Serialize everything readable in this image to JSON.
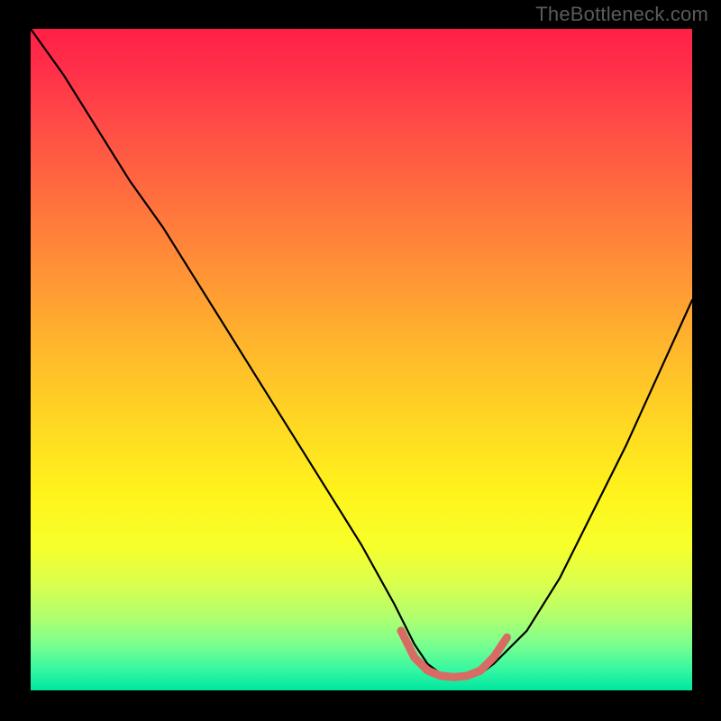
{
  "watermark": "TheBottleneck.com",
  "chart_data": {
    "type": "line",
    "title": "",
    "xlabel": "",
    "ylabel": "",
    "xlim": [
      0,
      100
    ],
    "ylim": [
      0,
      100
    ],
    "grid": false,
    "legend": false,
    "annotations": [],
    "series": [
      {
        "name": "curve",
        "color": "#000000",
        "x": [
          0,
          5,
          10,
          15,
          20,
          25,
          30,
          35,
          40,
          45,
          50,
          55,
          58,
          60,
          62,
          65,
          68,
          70,
          75,
          80,
          85,
          90,
          95,
          100
        ],
        "y": [
          100,
          93,
          85,
          77,
          70,
          62,
          54,
          46,
          38,
          30,
          22,
          13,
          7,
          4,
          2.5,
          2,
          2.5,
          4,
          9,
          17,
          27,
          37,
          48,
          59
        ]
      },
      {
        "name": "highlight",
        "color": "#d86b64",
        "x": [
          56,
          58,
          60,
          62,
          64,
          66,
          68,
          70,
          72
        ],
        "y": [
          9,
          5,
          3,
          2.2,
          2,
          2.2,
          3,
          5,
          8
        ]
      }
    ],
    "gradient_colors": {
      "top": "#ff2046",
      "mid": "#ffd324",
      "bottom": "#00e6a0"
    }
  }
}
